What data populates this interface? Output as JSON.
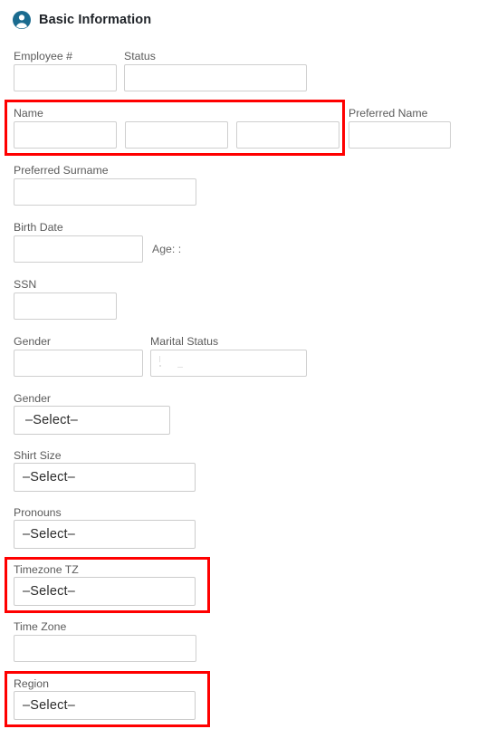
{
  "header": {
    "icon": "user-avatar-icon",
    "title": "Basic Information",
    "icon_color": "#1a6b8f"
  },
  "highlight_color": "#ff0000",
  "select_placeholder": "–Select–",
  "fields": {
    "employee_number": {
      "label": "Employee #",
      "value": ""
    },
    "status": {
      "label": "Status",
      "value": ""
    },
    "name": {
      "label": "Name",
      "first": "",
      "middle": "",
      "last": "",
      "highlighted": true
    },
    "preferred_name": {
      "label": "Preferred Name",
      "value": ""
    },
    "preferred_surname": {
      "label": "Preferred Surname",
      "value": ""
    },
    "birth_date": {
      "label": "Birth Date",
      "value": ""
    },
    "age": {
      "label": "Age: :",
      "value": ""
    },
    "ssn": {
      "label": "SSN",
      "value": ""
    },
    "gender_text": {
      "label": "Gender",
      "value": ""
    },
    "marital_status": {
      "label": "Marital Status",
      "value": ""
    },
    "gender_select": {
      "label": "Gender",
      "value": "–Select–"
    },
    "shirt_size": {
      "label": "Shirt Size",
      "value": "–Select–"
    },
    "pronouns": {
      "label": "Pronouns",
      "value": "–Select–"
    },
    "timezone_tz": {
      "label": "Timezone TZ",
      "value": "–Select–",
      "highlighted": true
    },
    "time_zone": {
      "label": "Time Zone",
      "value": ""
    },
    "region": {
      "label": "Region",
      "value": "–Select–",
      "highlighted": true
    }
  }
}
